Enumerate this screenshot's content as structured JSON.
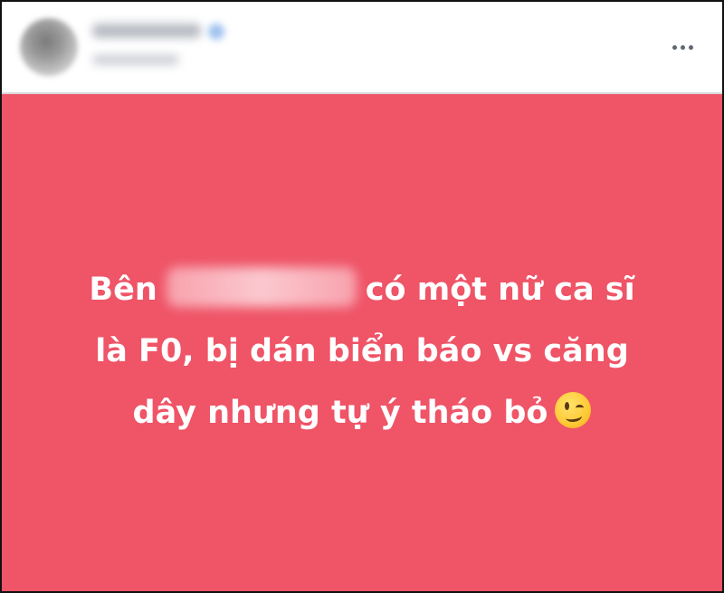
{
  "header": {
    "more_icon": "more-horizontal-icon"
  },
  "post": {
    "background_color": "#ef5467",
    "text_color": "#ffffff",
    "lines": [
      {
        "before": "Bên",
        "after": "có một nữ ca sĩ"
      },
      {
        "text": "là F0, bị dán biển báo vs căng"
      },
      {
        "text": "dây nhưng tự ý tháo bỏ"
      }
    ],
    "emoji": "winking-face-icon"
  }
}
